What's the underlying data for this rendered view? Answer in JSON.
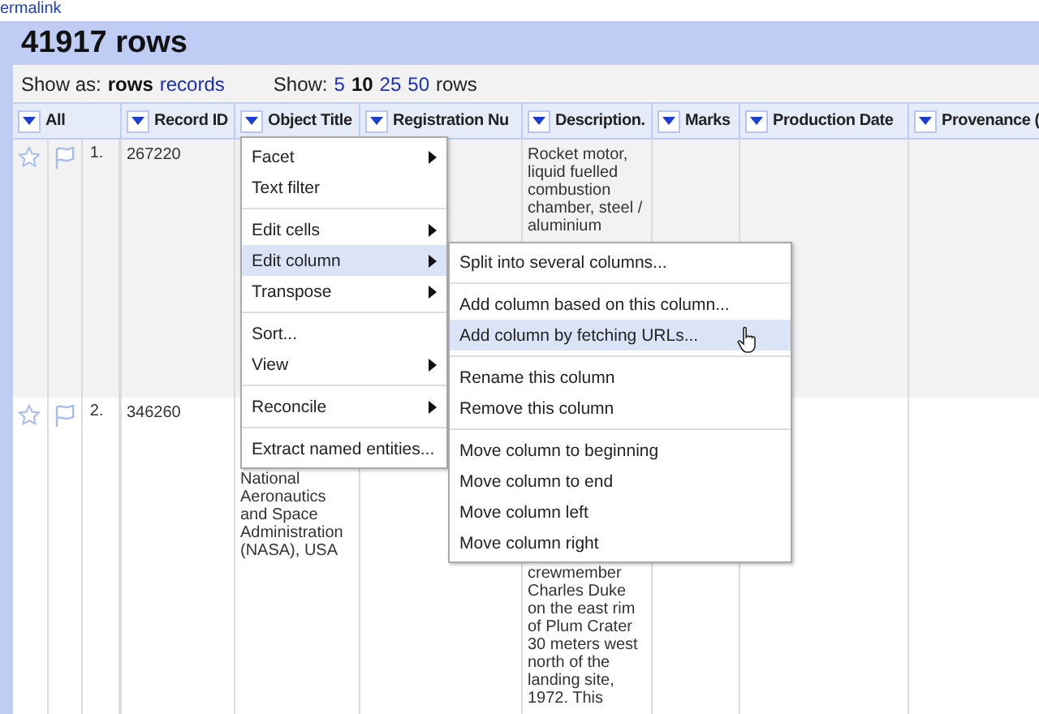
{
  "permalink": "ermalink",
  "title": "41917 rows",
  "view_bar": {
    "show_as_label": "Show as:",
    "modes": [
      {
        "label": "rows",
        "selected": true
      },
      {
        "label": "records",
        "selected": false
      }
    ],
    "show_label": "Show:",
    "page_sizes": [
      {
        "label": "5",
        "selected": false
      },
      {
        "label": "10",
        "selected": true
      },
      {
        "label": "25",
        "selected": false
      },
      {
        "label": "50",
        "selected": false
      }
    ],
    "rows_label": "rows"
  },
  "table": {
    "columns": [
      "All",
      "Record ID",
      "Object Title",
      "Registration Nu",
      "Description.",
      "Marks",
      "Production Date",
      "Provenance ("
    ],
    "rows": [
      {
        "starred": false,
        "flagged": false,
        "index": "1.",
        "record_id": "267220",
        "description": "Rocket motor, liquid fuelled combustion chamber, steel / aluminium"
      },
      {
        "starred": false,
        "flagged": false,
        "index": "2.",
        "record_id": "346260",
        "object_title": "National Aeronautics and Space Administration (NASA), USA",
        "description": "crewmember Charles Duke on the east rim of Plum Crater 30 meters west north of the landing site, 1972. This"
      }
    ]
  },
  "column_menu": {
    "items": [
      {
        "kind": "item",
        "label": "Facet",
        "submenu": true,
        "selected": false
      },
      {
        "kind": "item",
        "label": "Text filter",
        "submenu": false,
        "selected": false
      },
      {
        "kind": "separator"
      },
      {
        "kind": "item",
        "label": "Edit cells",
        "submenu": true,
        "selected": false
      },
      {
        "kind": "item",
        "label": "Edit column",
        "submenu": true,
        "selected": true
      },
      {
        "kind": "item",
        "label": "Transpose",
        "submenu": true,
        "selected": false
      },
      {
        "kind": "separator"
      },
      {
        "kind": "item",
        "label": "Sort...",
        "submenu": false,
        "selected": false
      },
      {
        "kind": "item",
        "label": "View",
        "submenu": true,
        "selected": false
      },
      {
        "kind": "separator"
      },
      {
        "kind": "item",
        "label": "Reconcile",
        "submenu": true,
        "selected": false
      },
      {
        "kind": "separator"
      },
      {
        "kind": "item",
        "label": "Extract named entities...",
        "submenu": false,
        "selected": false
      }
    ]
  },
  "edit_column_submenu": {
    "items": [
      {
        "kind": "item",
        "label": "Split into several columns...",
        "submenu": false,
        "selected": false
      },
      {
        "kind": "separator"
      },
      {
        "kind": "item",
        "label": "Add column based on this column...",
        "submenu": false,
        "selected": false
      },
      {
        "kind": "item",
        "label": "Add column by fetching URLs...",
        "submenu": false,
        "selected": true
      },
      {
        "kind": "separator"
      },
      {
        "kind": "item",
        "label": "Rename this column",
        "submenu": false,
        "selected": false
      },
      {
        "kind": "item",
        "label": "Remove this column",
        "submenu": false,
        "selected": false
      },
      {
        "kind": "separator"
      },
      {
        "kind": "item",
        "label": "Move column to beginning",
        "submenu": false,
        "selected": false
      },
      {
        "kind": "item",
        "label": "Move column to end",
        "submenu": false,
        "selected": false
      },
      {
        "kind": "item",
        "label": "Move column left",
        "submenu": false,
        "selected": false
      },
      {
        "kind": "item",
        "label": "Move column right",
        "submenu": false,
        "selected": false
      }
    ]
  }
}
